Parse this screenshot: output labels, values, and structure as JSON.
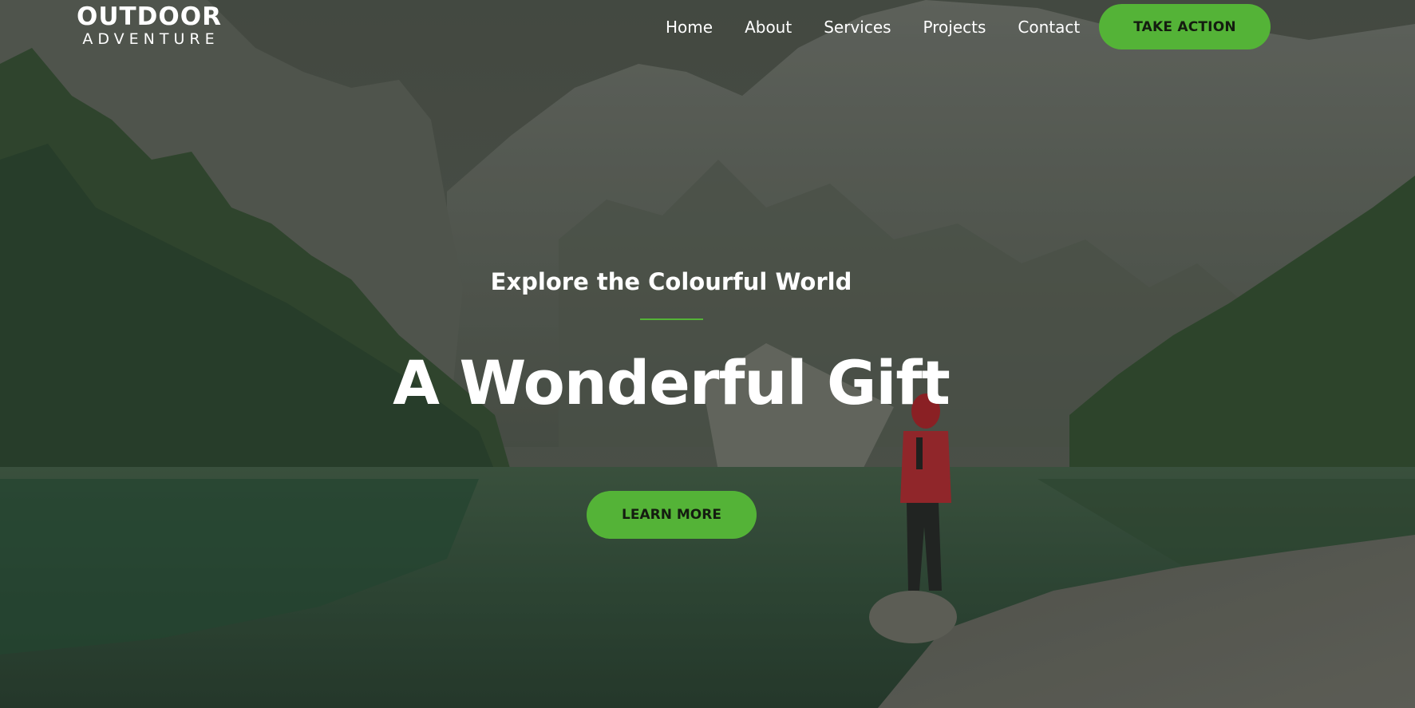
{
  "brand": {
    "name_main": "OUTDOOR",
    "name_sub": "ADVENTURE"
  },
  "nav": {
    "items": [
      {
        "label": "Home"
      },
      {
        "label": "About"
      },
      {
        "label": "Services"
      },
      {
        "label": "Projects"
      },
      {
        "label": "Contact"
      }
    ],
    "cta_label": "TAKE ACTION"
  },
  "hero": {
    "tagline": "Explore the Colourful World",
    "headline": "A Wonderful Gift",
    "button_label": "LEARN MORE"
  },
  "colors": {
    "accent": "#54b337",
    "overlay": "#2e332c",
    "text": "#ffffff"
  }
}
